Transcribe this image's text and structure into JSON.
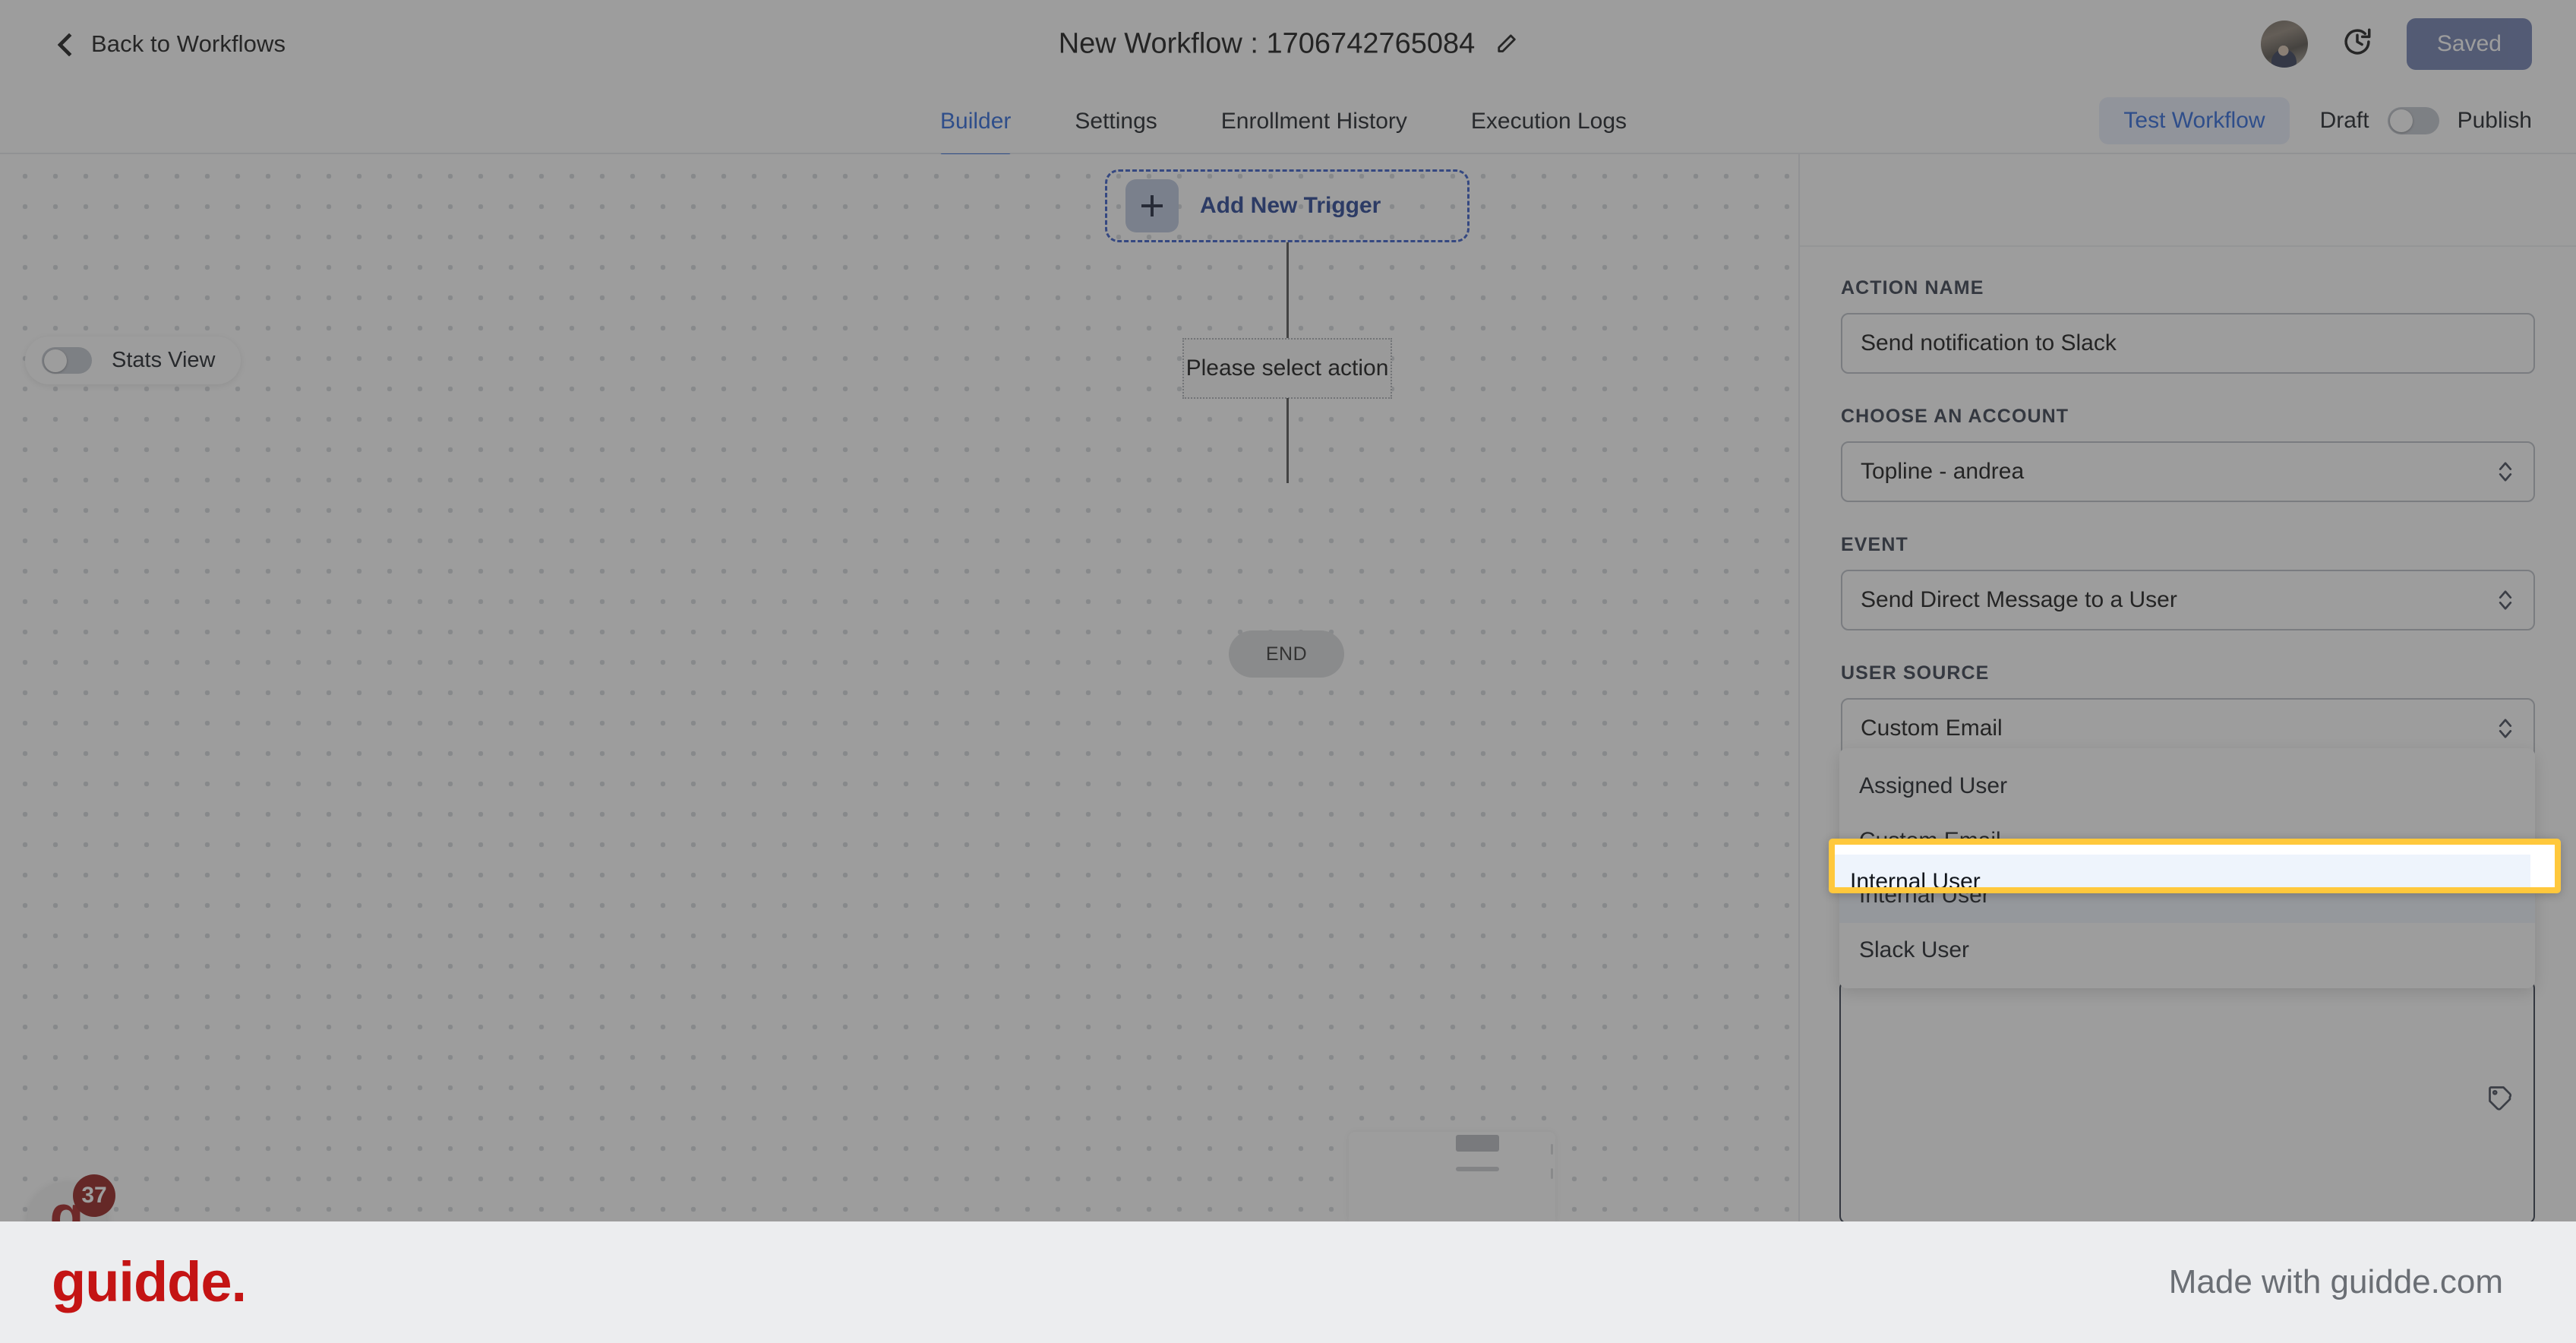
{
  "header": {
    "back_label": "Back to Workflows",
    "back_icon": "chevron-left-icon",
    "workflow_title": "New Workflow : 1706742765084",
    "edit_icon": "pencil-icon",
    "history_icon": "clock-history-icon",
    "avatar": "user-avatar",
    "saved_label": "Saved"
  },
  "tabs": [
    {
      "label": "Builder",
      "active": true
    },
    {
      "label": "Settings",
      "active": false
    },
    {
      "label": "Enrollment History",
      "active": false
    },
    {
      "label": "Execution Logs",
      "active": false
    }
  ],
  "tabsbar_right": {
    "test_workflow_label": "Test Workflow",
    "draft_label": "Draft",
    "publish_label": "Publish",
    "publish_toggle_state": "off"
  },
  "canvas": {
    "stats_view_label": "Stats View",
    "stats_view_toggle_state": "off",
    "add_trigger_label": "Add New Trigger",
    "add_trigger_icon": "plus-icon",
    "select_action_label": "Please select action",
    "end_label": "END"
  },
  "panel": {
    "action_name": {
      "label": "ACTION NAME",
      "value": "Send notification to Slack"
    },
    "account": {
      "label": "CHOOSE AN ACCOUNT",
      "value": "Topline - andrea"
    },
    "event": {
      "label": "EVENT",
      "value": "Send Direct Message to a User"
    },
    "user_source": {
      "label": "USER SOURCE",
      "value": "Custom Email",
      "options": [
        "Assigned User",
        "Custom Email",
        "Internal User",
        "Slack User"
      ],
      "hovered_option": "Internal User"
    },
    "message_area": {
      "value": "",
      "tag_icon": "tag-icon"
    }
  },
  "widget": {
    "badge_count": "37",
    "logo_glyph": "g"
  },
  "banner": {
    "logo": "guidde.",
    "text": "Made with guidde.com"
  },
  "colors": {
    "accent_blue": "#2260d9",
    "saved_blue": "#4a5d9c",
    "highlight_yellow": "#ffc83c",
    "brand_red": "#c41414",
    "hover_row": "#eef4fc"
  }
}
